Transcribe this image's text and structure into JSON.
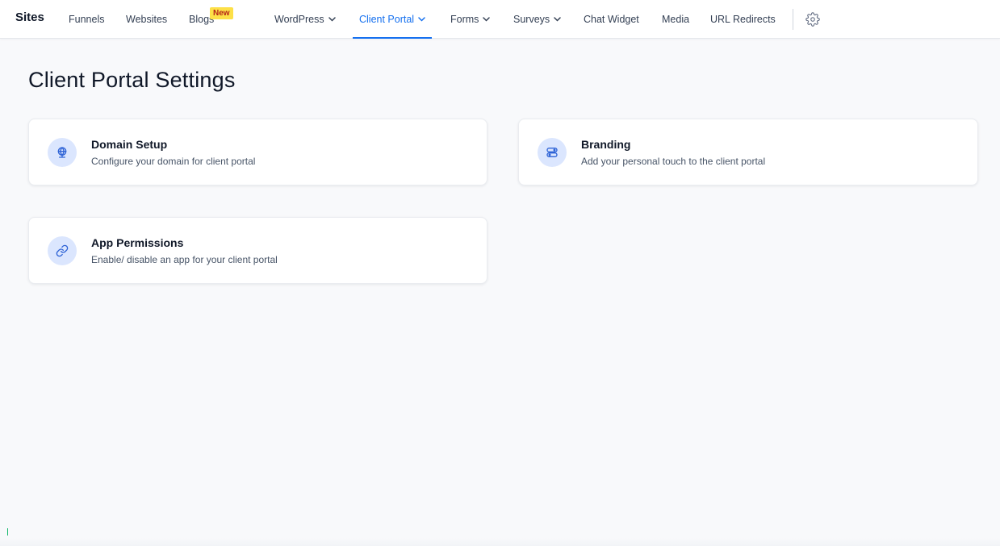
{
  "header": {
    "brand": "Sites",
    "nav": [
      {
        "label": "Funnels"
      },
      {
        "label": "Websites"
      },
      {
        "label": "Blogs",
        "badge": "New"
      },
      {
        "label": "WordPress",
        "dropdown": true
      },
      {
        "label": "Client Portal",
        "dropdown": true,
        "active": true
      },
      {
        "label": "Forms",
        "dropdown": true
      },
      {
        "label": "Surveys",
        "dropdown": true
      },
      {
        "label": "Chat Widget"
      },
      {
        "label": "Media"
      },
      {
        "label": "URL Redirects"
      }
    ],
    "settings_icon": "gear-icon"
  },
  "page": {
    "title": "Client Portal Settings"
  },
  "cards": [
    {
      "title": "Domain Setup",
      "description": "Configure your domain for client portal",
      "icon": "globe-icon"
    },
    {
      "title": "Branding",
      "description": "Add your personal touch to the client portal",
      "icon": "toggles-icon"
    },
    {
      "title": "App Permissions",
      "description": "Enable/ disable an app for your client portal",
      "icon": "link-icon"
    }
  ],
  "colors": {
    "accent": "#1570ef",
    "icon_bg": "#dbe6fe",
    "icon_fg": "#2e63d6",
    "badge_bg": "#fde047"
  }
}
